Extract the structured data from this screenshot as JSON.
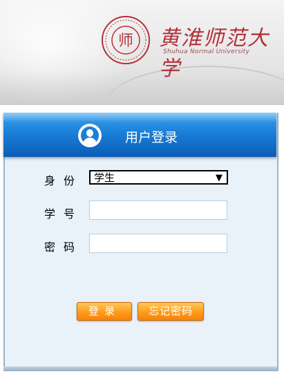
{
  "banner": {
    "university_name": "黄淮师范大学",
    "university_name_en": "Shuhua Normal University",
    "seal_text": "师"
  },
  "login_panel": {
    "title": "用户登录"
  },
  "form": {
    "identity_label": "身份",
    "identity_value": "学生",
    "student_id_label": "学号",
    "student_id_value": "",
    "password_label": "密码",
    "password_value": ""
  },
  "buttons": {
    "login": "登录",
    "forgot_password": "忘记密码"
  },
  "colors": {
    "header_blue": "#1a7fd8",
    "button_orange": "#ff9f1e",
    "panel_bg": "#e9f1f9",
    "brand_red": "#b3303a"
  }
}
